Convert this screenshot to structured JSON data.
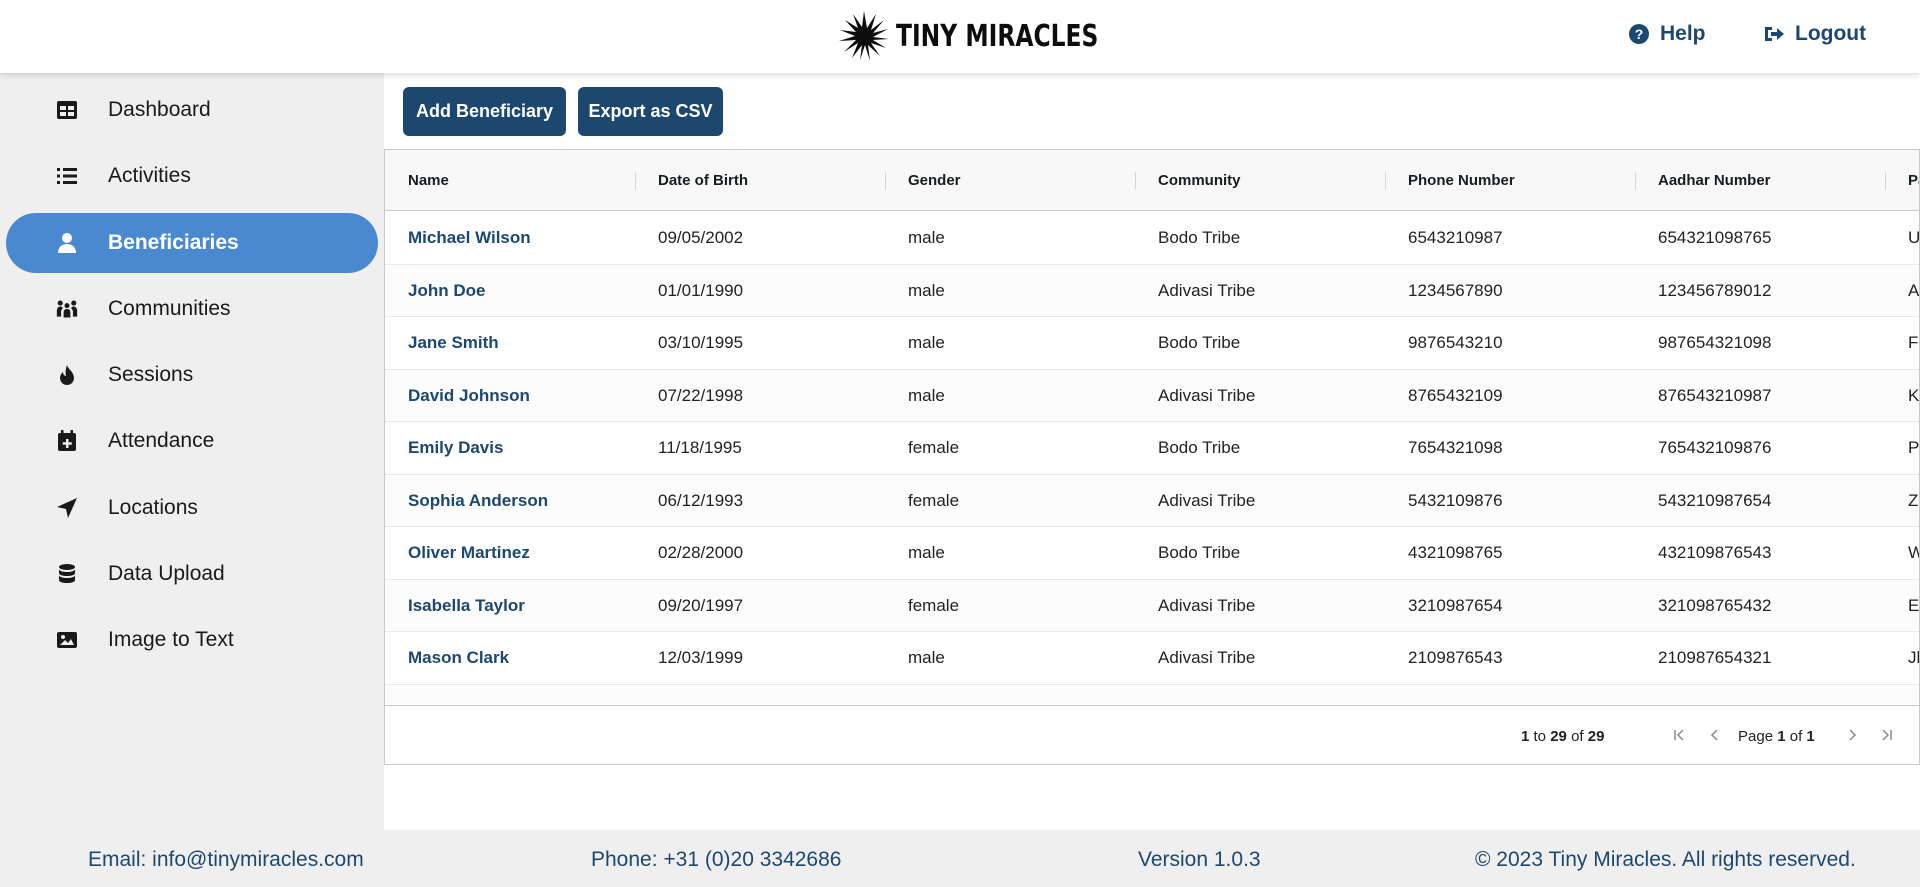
{
  "header": {
    "logo_text": "TINY MIRACLES",
    "help_label": "Help",
    "logout_label": "Logout"
  },
  "sidebar": {
    "items": [
      {
        "label": "Dashboard",
        "icon": "table-icon"
      },
      {
        "label": "Activities",
        "icon": "list-icon"
      },
      {
        "label": "Beneficiaries",
        "icon": "user-icon",
        "active": true
      },
      {
        "label": "Communities",
        "icon": "people-group-icon"
      },
      {
        "label": "Sessions",
        "icon": "fire-icon"
      },
      {
        "label": "Attendance",
        "icon": "calendar-plus-icon"
      },
      {
        "label": "Locations",
        "icon": "location-arrow-icon"
      },
      {
        "label": "Data Upload",
        "icon": "database-icon"
      },
      {
        "label": "Image to Text",
        "icon": "image-icon"
      }
    ]
  },
  "toolbar": {
    "add_label": "Add Beneficiary",
    "export_label": "Export as CSV"
  },
  "table": {
    "columns": [
      "Name",
      "Date of Birth",
      "Gender",
      "Community",
      "Phone Number",
      "Aadhar Number",
      "Pa"
    ],
    "rows": [
      [
        "Michael Wilson",
        "09/05/2002",
        "male",
        "Bodo Tribe",
        "6543210987",
        "654321098765",
        "U"
      ],
      [
        "John Doe",
        "01/01/1990",
        "male",
        "Adivasi Tribe",
        "1234567890",
        "123456789012",
        "A"
      ],
      [
        "Jane Smith",
        "03/10/1995",
        "male",
        "Bodo Tribe",
        "9876543210",
        "987654321098",
        "F("
      ],
      [
        "David Johnson",
        "07/22/1998",
        "male",
        "Adivasi Tribe",
        "8765432109",
        "876543210987",
        "K"
      ],
      [
        "Emily Davis",
        "11/18/1995",
        "female",
        "Bodo Tribe",
        "7654321098",
        "765432109876",
        "P("
      ],
      [
        "Sophia Anderson",
        "06/12/1993",
        "female",
        "Adivasi Tribe",
        "5432109876",
        "543210987654",
        "Z"
      ],
      [
        "Oliver Martinez",
        "02/28/2000",
        "male",
        "Bodo Tribe",
        "4321098765",
        "432109876543",
        "W"
      ],
      [
        "Isabella Taylor",
        "09/20/1997",
        "female",
        "Adivasi Tribe",
        "3210987654",
        "321098765432",
        "El"
      ],
      [
        "Mason Clark",
        "12/03/1999",
        "male",
        "Adivasi Tribe",
        "2109876543",
        "210987654321",
        "Jk"
      ]
    ]
  },
  "pagination": {
    "from": "1",
    "to_word": "to",
    "to": "29",
    "of_word": "of",
    "total": "29",
    "page_word": "Page",
    "page": "1",
    "page_of_word": "of",
    "page_total": "1"
  },
  "footer": {
    "email": "Email: info@tinymiracles.com",
    "phone": "Phone: +31 (0)20 3342686",
    "version": "Version 1.0.3",
    "copyright": "© 2023 Tiny Miracles. All rights reserved."
  },
  "colors": {
    "brand": "#1c4870",
    "active_nav": "#4a89cf",
    "sidebar_bg": "#efefef"
  }
}
